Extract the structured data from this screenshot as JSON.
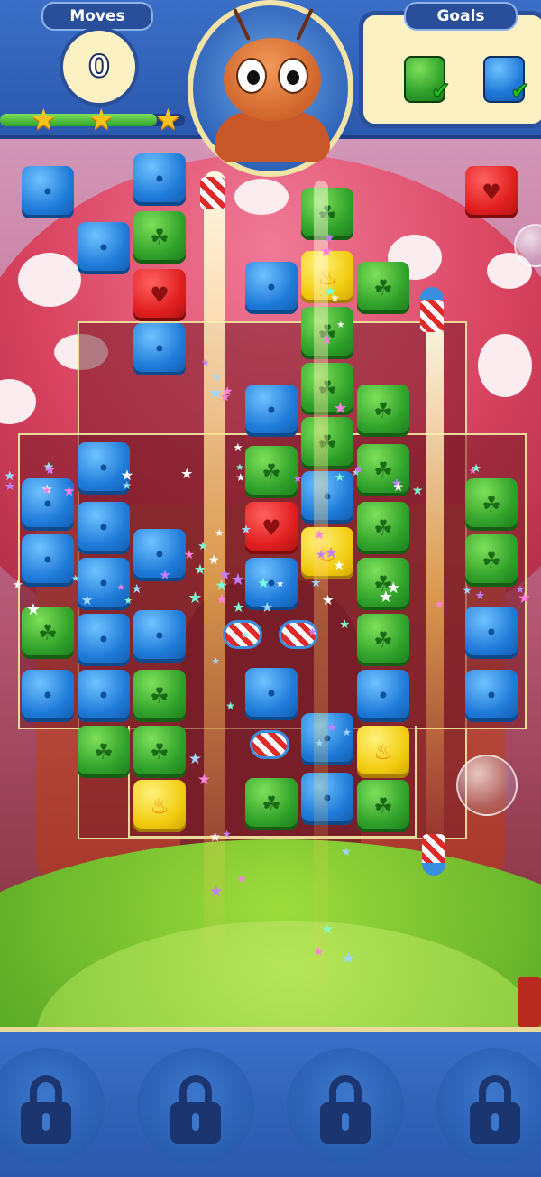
{
  "header": {
    "moves_label": "Moves",
    "moves_value": "0",
    "goals_label": "Goals",
    "progress_fraction": 0.85,
    "stars_earned": 3
  },
  "goals": [
    {
      "type": "green-leaf-cube",
      "status": "complete"
    },
    {
      "type": "blue-drop-cube",
      "status": "complete"
    }
  ],
  "character": "ant",
  "colors": {
    "blue": "#1e7ad8",
    "green": "#2fa12a",
    "red": "#e01e1e",
    "yellow": "#f1cc10",
    "ui_blue": "#2a58ad",
    "panel_cream": "#fbf1c2"
  },
  "icons": {
    "blue": "drop-icon",
    "green": "leaf-icon",
    "red": "heart-icon",
    "yellow": "flame-icon",
    "booster_slot": "lock-icon"
  },
  "boosters": [
    {
      "state": "locked"
    },
    {
      "state": "locked"
    },
    {
      "state": "locked"
    },
    {
      "state": "locked"
    }
  ]
}
